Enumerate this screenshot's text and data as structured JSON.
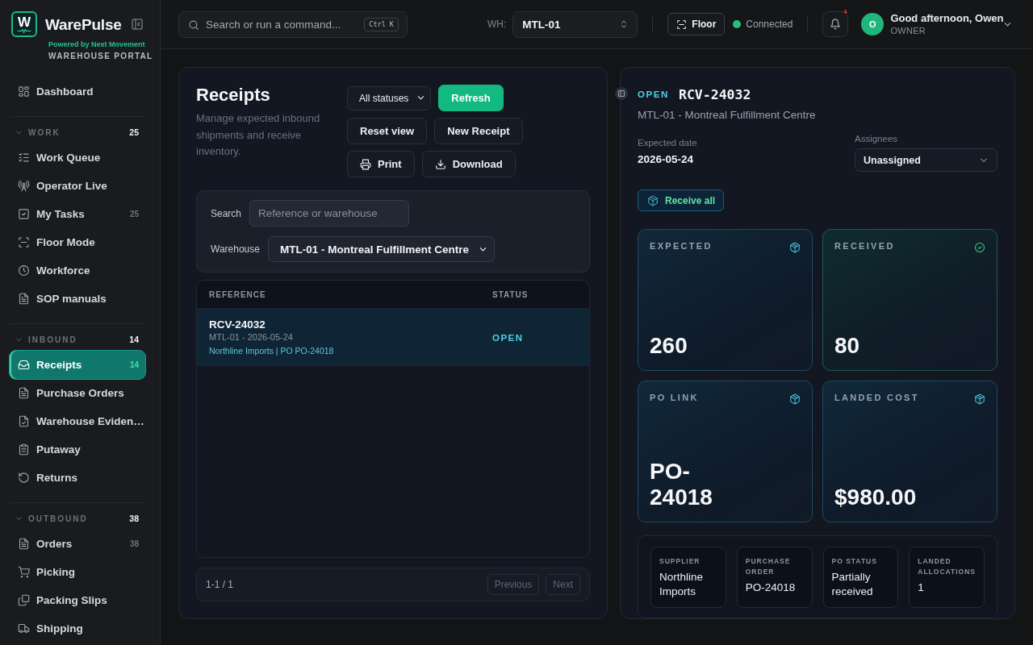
{
  "sidebar": {
    "brand": {
      "logo_letter": "W",
      "name": "WarePulse",
      "tagline": "Powered by Next Movement",
      "subtitle": "WAREHOUSE PORTAL"
    },
    "items": [
      {
        "label": "Dashboard",
        "selected": false
      }
    ],
    "sections": [
      {
        "title": "WORK",
        "count": "25",
        "expanded": true,
        "items": [
          {
            "label": "Work Queue",
            "selected": false
          },
          {
            "label": "Operator Live",
            "selected": false
          },
          {
            "label": "My Tasks",
            "count": "25",
            "selected": false
          },
          {
            "label": "Floor Mode",
            "selected": false
          },
          {
            "label": "Workforce",
            "selected": false
          },
          {
            "label": "SOP manuals",
            "selected": false
          }
        ]
      },
      {
        "title": "INBOUND",
        "count": "14",
        "expanded": true,
        "items": [
          {
            "label": "Receipts",
            "count": "14",
            "selected": true
          },
          {
            "label": "Purchase Orders",
            "selected": false
          },
          {
            "label": "Warehouse Eviden…",
            "selected": false
          },
          {
            "label": "Putaway",
            "selected": false
          },
          {
            "label": "Returns",
            "selected": false
          }
        ]
      },
      {
        "title": "OUTBOUND",
        "count": "38",
        "expanded": true,
        "items": [
          {
            "label": "Orders",
            "count": "38",
            "selected": false
          },
          {
            "label": "Picking",
            "selected": false
          },
          {
            "label": "Packing Slips",
            "selected": false
          },
          {
            "label": "Shipping",
            "selected": false
          }
        ]
      }
    ]
  },
  "topbar": {
    "search": {
      "placeholder": "Search or run a command...",
      "shortcut": "Ctrl K"
    },
    "warehouse": {
      "label": "WH:",
      "value": "MTL-01"
    },
    "floor_button": "Floor",
    "connection": {
      "label": "Connected",
      "on": true
    },
    "notifications": {
      "badge": "4"
    },
    "user": {
      "initial": "O",
      "greeting": "Good afternoon, Owen",
      "role": "OWNER"
    }
  },
  "receipts": {
    "title": "Receipts",
    "description": "Manage expected inbound shipments and receive inventory.",
    "status_filter": "All statuses",
    "actions": [
      {
        "label": "Refresh",
        "kind": "primary"
      },
      {
        "label": "Reset view",
        "kind": "secondary"
      },
      {
        "label": "New Receipt",
        "kind": "secondary"
      },
      {
        "label": "Print",
        "kind": "secondary"
      },
      {
        "label": "Download",
        "kind": "secondary"
      }
    ],
    "filters": {
      "search": {
        "label": "Search",
        "placeholder": "Reference or warehouse"
      },
      "warehouse": {
        "label": "Warehouse",
        "value": "MTL-01 - Montreal Fulfillment Centre"
      }
    },
    "table": {
      "columns": [
        "REFERENCE",
        "STATUS"
      ],
      "rows": [
        {
          "reference": "RCV-24032",
          "meta": "MTL-01 - 2026-05-24",
          "links": "Northline Imports | PO PO-24018",
          "status": "OPEN",
          "selected": true
        }
      ]
    },
    "pagination": {
      "summary": "1-1 / 1",
      "previous": {
        "label": "Previous",
        "disabled": true
      },
      "next": {
        "label": "Next",
        "disabled": true
      }
    }
  },
  "detail": {
    "status": "OPEN",
    "reference": "RCV-24032",
    "warehouse": "MTL-01 - Montreal Fulfillment Centre",
    "expected_date": {
      "label": "Expected date",
      "value": "2026-05-24"
    },
    "assignees": {
      "label": "Assignees",
      "value": "Unassigned"
    },
    "receive_button": "Receive all",
    "stats": [
      {
        "label": "EXPECTED",
        "value": "260",
        "kind": "neutral"
      },
      {
        "label": "RECEIVED",
        "value": "80",
        "kind": "success"
      },
      {
        "label": "PO LINK",
        "value": "PO-24018",
        "kind": "neutral"
      },
      {
        "label": "LANDED COST",
        "value": "$980.00",
        "kind": "neutral"
      }
    ],
    "summary": [
      {
        "label": "SUPPLIER",
        "value": "Northline Imports"
      },
      {
        "label": "PURCHASE ORDER",
        "value": "PO-24018"
      },
      {
        "label": "PO STATUS",
        "value": "Partially received"
      },
      {
        "label": "LANDED ALLOCATIONS",
        "value": "1"
      }
    ]
  }
}
